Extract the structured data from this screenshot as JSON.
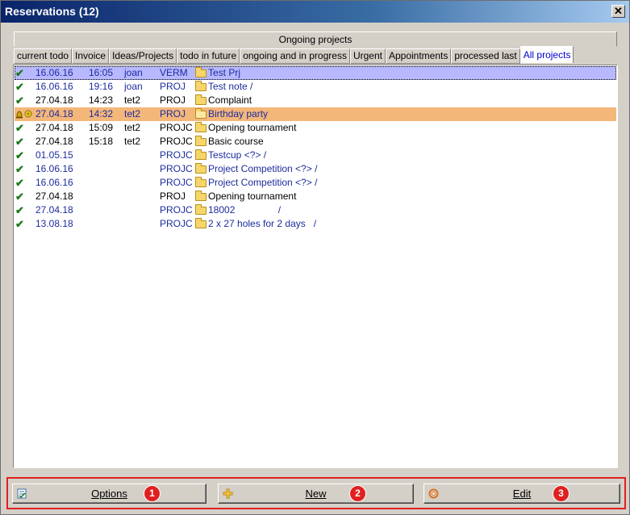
{
  "window": {
    "title": "Reservations (12)",
    "close_glyph": "✕"
  },
  "group_tab": {
    "label": "Ongoing projects"
  },
  "tabs": [
    {
      "label": "current todo"
    },
    {
      "label": "Invoice"
    },
    {
      "label": "Ideas/Projects"
    },
    {
      "label": "todo in future"
    },
    {
      "label": "ongoing and in progress"
    },
    {
      "label": "Urgent"
    },
    {
      "label": "Appointments"
    },
    {
      "label": "processed last"
    },
    {
      "label": "All projects",
      "active": true
    }
  ],
  "rows": [
    {
      "status": "check",
      "date": "16.06.16",
      "time": "16:05",
      "user": "joan",
      "type": "VERM",
      "folder": "folder-icon",
      "desc": "Test Prj",
      "style": "selected blue"
    },
    {
      "status": "check",
      "date": "16.06.16",
      "time": "19:16",
      "user": "joan",
      "type": "PROJ",
      "folder": "folder-icon",
      "desc": "Test note /",
      "style": "blue"
    },
    {
      "status": "check",
      "date": "27.04.18",
      "time": "14:23",
      "user": "tet2",
      "type": "PROJ",
      "folder": "folder-icon",
      "desc": "Complaint",
      "style": ""
    },
    {
      "status": "bell",
      "date": "27.04.18",
      "time": "14:32",
      "user": "tet2",
      "type": "PROJ",
      "folder": "open-folder-icon",
      "desc": "Birthday party",
      "style": "highlight blue"
    },
    {
      "status": "check",
      "date": "27.04.18",
      "time": "15:09",
      "user": "tet2",
      "type": "PROJC",
      "folder": "folder-icon",
      "desc": "Opening tournament",
      "style": ""
    },
    {
      "status": "check",
      "date": "27.04.18",
      "time": "15:18",
      "user": "tet2",
      "type": "PROJC",
      "folder": "folder-icon",
      "desc": "Basic course",
      "style": ""
    },
    {
      "status": "check",
      "date": "01.05.15",
      "time": "",
      "user": "",
      "type": "PROJC",
      "folder": "folder-icon",
      "desc": "Testcup <?> /",
      "style": "blue"
    },
    {
      "status": "check",
      "date": "16.06.16",
      "time": "",
      "user": "",
      "type": "PROJC",
      "folder": "folder-icon",
      "desc": "Project Competition <?> /",
      "style": "blue"
    },
    {
      "status": "check",
      "date": "16.06.16",
      "time": "",
      "user": "",
      "type": "PROJC",
      "folder": "folder-icon",
      "desc": "Project Competition <?> /",
      "style": "blue"
    },
    {
      "status": "check",
      "date": "27.04.18",
      "time": "",
      "user": "",
      "type": "PROJ",
      "folder": "folder-icon",
      "desc": "Opening tournament",
      "style": ""
    },
    {
      "status": "check",
      "date": "27.04.18",
      "time": "",
      "user": "",
      "type": "PROJC",
      "folder": "folder-icon",
      "desc": "18002                /",
      "style": "blue"
    },
    {
      "status": "check",
      "date": "13.08.18",
      "time": "",
      "user": "",
      "type": "PROJC",
      "folder": "folder-icon",
      "desc": "2 x 27 holes for 2 days   /",
      "style": "blue"
    }
  ],
  "buttons": {
    "options": {
      "label": "Options",
      "badge": "1",
      "icon": "options-icon"
    },
    "new": {
      "label": "New",
      "badge": "2",
      "icon": "plus-icon"
    },
    "edit": {
      "label": "Edit",
      "badge": "3",
      "icon": "edit-ring-icon"
    }
  },
  "colors": {
    "badge": "#e02020",
    "highlight_row": "#f4b77a",
    "selected_row": "#b8b8ff",
    "blue_text": "#1c2c9c",
    "check": "#1a7a1a"
  }
}
